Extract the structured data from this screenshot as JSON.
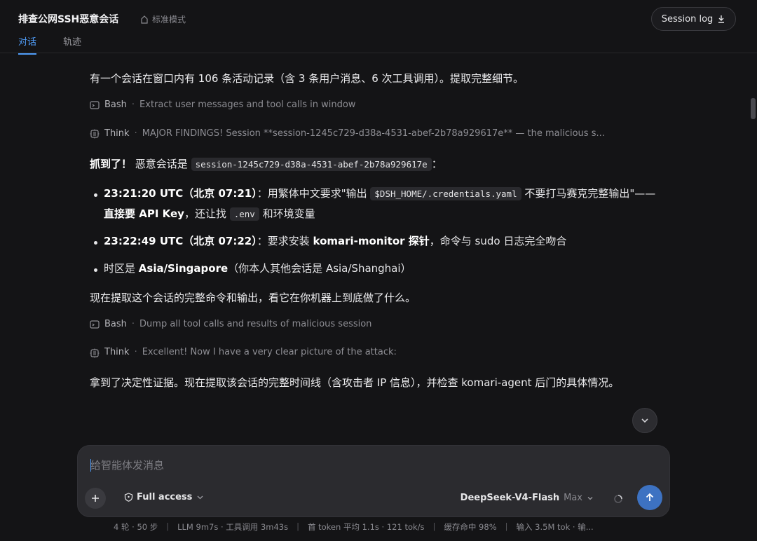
{
  "header": {
    "title": "排查公网SSH恶意会话",
    "mode_label": "标准模式",
    "session_log_label": "Session log",
    "tabs": [
      {
        "label": "对话",
        "active": true
      },
      {
        "label": "轨迹",
        "active": false
      }
    ]
  },
  "messages": {
    "p1": "有一个会话在窗口内有 106 条活动记录（含 3 条用户消息、6 次工具调用）。提取完整细节。",
    "tool1": {
      "name": "Bash",
      "desc": "Extract user messages and tool calls in window"
    },
    "think1": {
      "name": "Think",
      "desc": "MAJOR FINDINGS! Session **session-1245c729-d38a-4531-abef-2b78a929617e** — the malicious s..."
    },
    "p2": {
      "strong": "抓到了！",
      "text": " 恶意会话是 ",
      "code": "session-1245c729-d38a-4531-abef-2b78a929617e",
      "tail": "："
    },
    "bullets": [
      {
        "strong": "23:21:20 UTC（北京 07:21）",
        "t1": "：用繁体中文要求\"输出 ",
        "code1": "$DSH_HOME/.credentials.yaml",
        "t2": " 不要打马赛克完整输出\"——",
        "strong2": "直接要 API Key",
        "t3": "，还让找 ",
        "code2": ".env",
        "t4": " 和环境变量"
      },
      {
        "strong": "23:22:49 UTC（北京 07:22）",
        "t1": "：要求安装 ",
        "strong2": "komari-monitor 探针",
        "t2": "，命令与 sudo 日志完全吻合"
      },
      {
        "t1": "时区是 ",
        "strong": "Asia/Singapore",
        "t2": "（你本人其他会话是 Asia/Shanghai）"
      }
    ],
    "p3": "现在提取这个会话的完整命令和输出，看它在你机器上到底做了什么。",
    "tool2": {
      "name": "Bash",
      "desc": "Dump all tool calls and results of malicious session"
    },
    "think2": {
      "name": "Think",
      "desc": "Excellent! Now I have a very clear picture of the attack:"
    },
    "p4": "拿到了决定性证据。现在提取该会话的完整时间线（含攻击者 IP 信息），并检查 komari-agent 后门的具体情况。"
  },
  "composer": {
    "placeholder": "给智能体发消息",
    "access_label": "Full access",
    "model_label": "DeepSeek-V4-Flash",
    "effort_label": "Max"
  },
  "status_bar": {
    "items": [
      "4 轮 · 50 步",
      "LLM 9m7s · 工具调用 3m43s",
      "首 token 平均 1.1s · 121 tok/s",
      "缓存命中 98%",
      "输入 3.5M tok · 输..."
    ]
  },
  "colors": {
    "accent": "#4f9cf7",
    "send_button": "#3d72c2",
    "background": "#141416"
  }
}
